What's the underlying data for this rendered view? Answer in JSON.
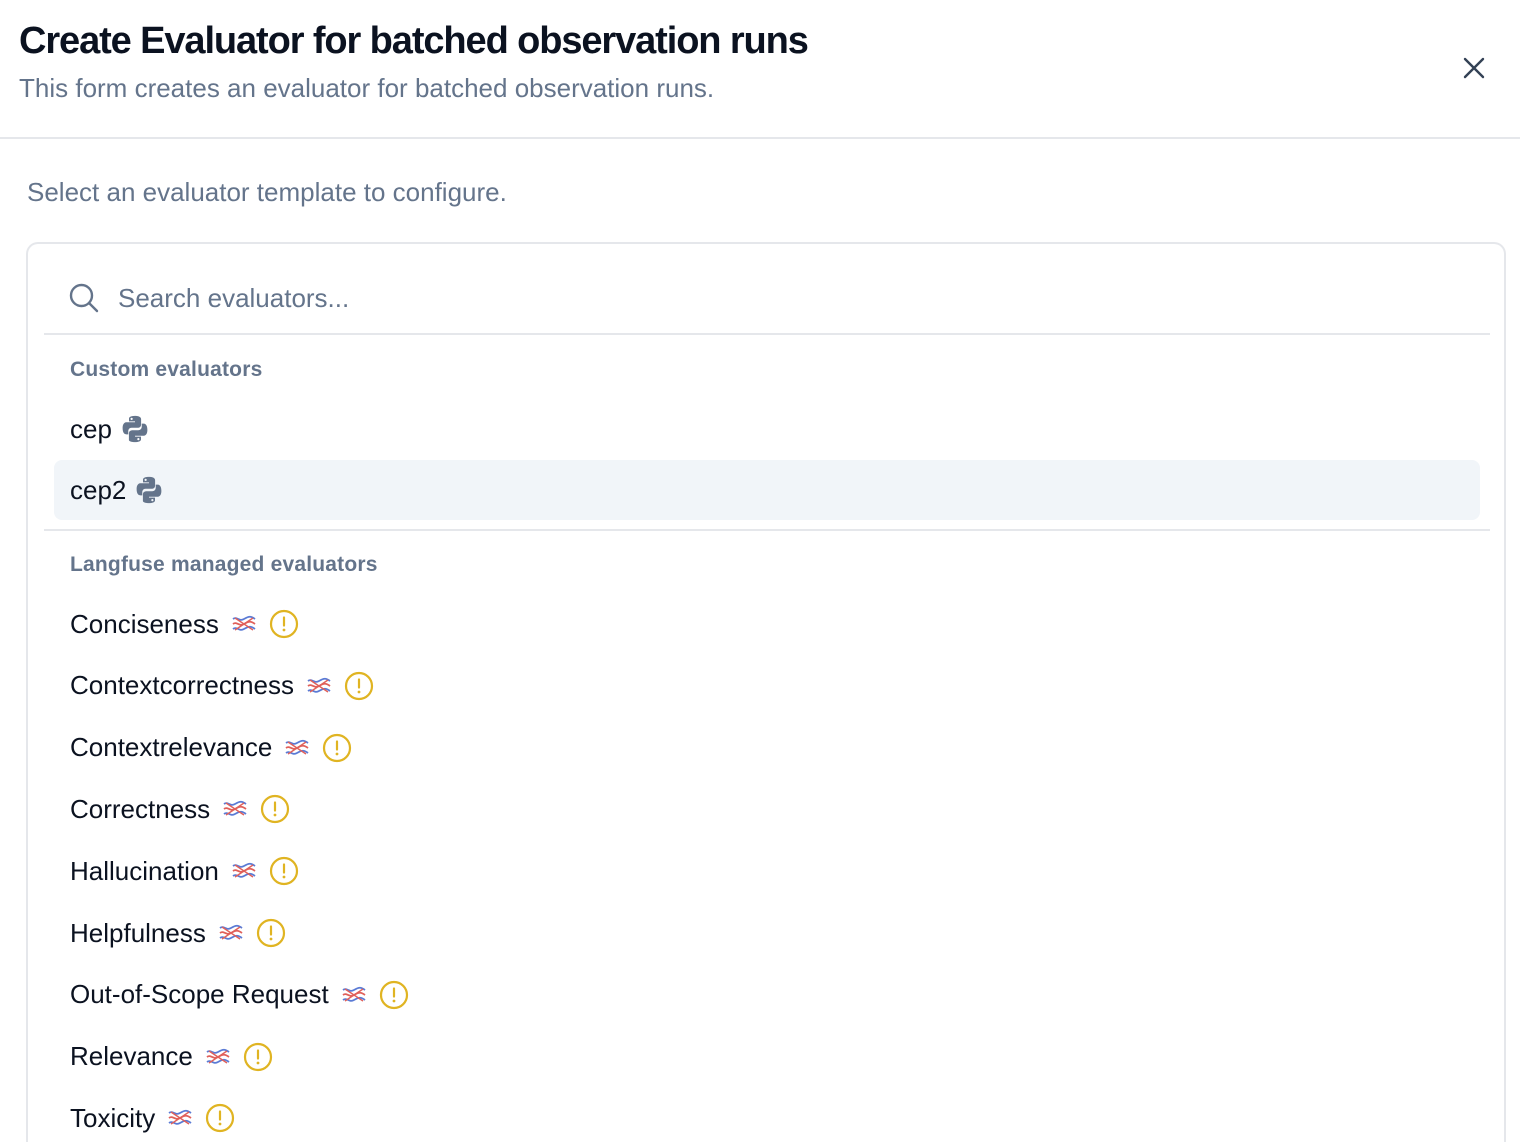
{
  "dialog": {
    "title": "Create Evaluator for batched observation runs",
    "subtitle": "This form creates an evaluator for batched observation runs.",
    "close_icon": "close-icon"
  },
  "instructions": "Select an evaluator template to configure.",
  "search": {
    "placeholder": "Search evaluators...",
    "value": "",
    "icon": "search-icon"
  },
  "groups": {
    "custom": {
      "heading": "Custom evaluators",
      "items": [
        {
          "label": "cep",
          "icon": "python-icon",
          "selected": false
        },
        {
          "label": "cep2",
          "icon": "python-icon",
          "selected": true
        }
      ]
    },
    "managed": {
      "heading": "Langfuse managed evaluators",
      "items": [
        {
          "label": "Conciseness",
          "icons": [
            "llm-icon",
            "warning-icon"
          ]
        },
        {
          "label": "Contextcorrectness",
          "icons": [
            "llm-icon",
            "warning-icon"
          ]
        },
        {
          "label": "Contextrelevance",
          "icons": [
            "llm-icon",
            "warning-icon"
          ]
        },
        {
          "label": "Correctness",
          "icons": [
            "llm-icon",
            "warning-icon"
          ]
        },
        {
          "label": "Hallucination",
          "icons": [
            "llm-icon",
            "warning-icon"
          ]
        },
        {
          "label": "Helpfulness",
          "icons": [
            "llm-icon",
            "warning-icon"
          ]
        },
        {
          "label": "Out-of-Scope Request",
          "icons": [
            "llm-icon",
            "warning-icon"
          ]
        },
        {
          "label": "Relevance",
          "icons": [
            "llm-icon",
            "warning-icon"
          ]
        },
        {
          "label": "Toxicity",
          "icons": [
            "llm-icon",
            "warning-icon"
          ]
        }
      ]
    }
  },
  "colors": {
    "selected_bg": "#f1f5f9",
    "muted_text": "#64748b",
    "warning": "#e0b422",
    "python_icon": "#64748b"
  }
}
